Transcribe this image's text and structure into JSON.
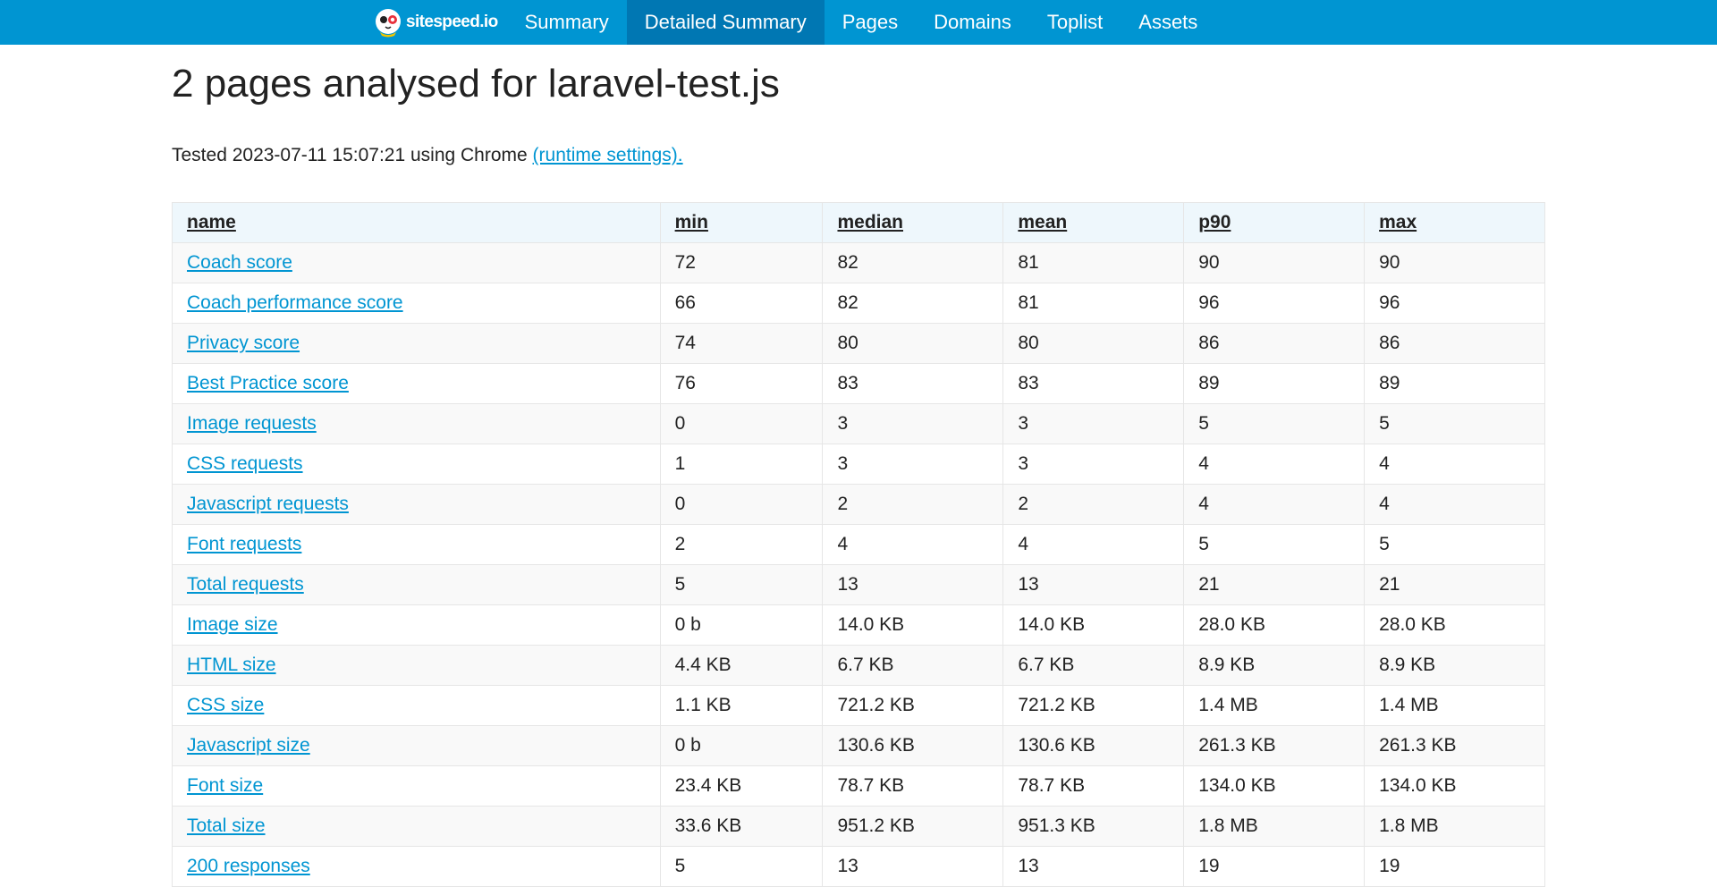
{
  "brand": {
    "name": "sitespeed.io"
  },
  "nav": {
    "items": [
      {
        "label": "Summary",
        "active": false
      },
      {
        "label": "Detailed Summary",
        "active": true
      },
      {
        "label": "Pages",
        "active": false
      },
      {
        "label": "Domains",
        "active": false
      },
      {
        "label": "Toplist",
        "active": false
      },
      {
        "label": "Assets",
        "active": false
      }
    ]
  },
  "page": {
    "title": "2 pages analysed for laravel-test.js",
    "tested_prefix": "Tested 2023-07-11 15:07:21 using Chrome ",
    "runtime_link": "(runtime settings)."
  },
  "table": {
    "headers": [
      "name",
      "min",
      "median",
      "mean",
      "p90",
      "max"
    ],
    "rows": [
      {
        "name": "Coach score",
        "min": "72",
        "median": "82",
        "mean": "81",
        "p90": "90",
        "max": "90"
      },
      {
        "name": "Coach performance score",
        "min": "66",
        "median": "82",
        "mean": "81",
        "p90": "96",
        "max": "96"
      },
      {
        "name": "Privacy score",
        "min": "74",
        "median": "80",
        "mean": "80",
        "p90": "86",
        "max": "86"
      },
      {
        "name": "Best Practice score",
        "min": "76",
        "median": "83",
        "mean": "83",
        "p90": "89",
        "max": "89"
      },
      {
        "name": "Image requests",
        "min": "0",
        "median": "3",
        "mean": "3",
        "p90": "5",
        "max": "5"
      },
      {
        "name": "CSS requests",
        "min": "1",
        "median": "3",
        "mean": "3",
        "p90": "4",
        "max": "4"
      },
      {
        "name": "Javascript requests",
        "min": "0",
        "median": "2",
        "mean": "2",
        "p90": "4",
        "max": "4"
      },
      {
        "name": "Font requests",
        "min": "2",
        "median": "4",
        "mean": "4",
        "p90": "5",
        "max": "5"
      },
      {
        "name": "Total requests",
        "min": "5",
        "median": "13",
        "mean": "13",
        "p90": "21",
        "max": "21"
      },
      {
        "name": "Image size",
        "min": "0 b",
        "median": "14.0 KB",
        "mean": "14.0 KB",
        "p90": "28.0 KB",
        "max": "28.0 KB"
      },
      {
        "name": "HTML size",
        "min": "4.4 KB",
        "median": "6.7 KB",
        "mean": "6.7 KB",
        "p90": "8.9 KB",
        "max": "8.9 KB"
      },
      {
        "name": "CSS size",
        "min": "1.1 KB",
        "median": "721.2 KB",
        "mean": "721.2 KB",
        "p90": "1.4 MB",
        "max": "1.4 MB"
      },
      {
        "name": "Javascript size",
        "min": "0 b",
        "median": "130.6 KB",
        "mean": "130.6 KB",
        "p90": "261.3 KB",
        "max": "261.3 KB"
      },
      {
        "name": "Font size",
        "min": "23.4 KB",
        "median": "78.7 KB",
        "mean": "78.7 KB",
        "p90": "134.0 KB",
        "max": "134.0 KB"
      },
      {
        "name": "Total size",
        "min": "33.6 KB",
        "median": "951.2 KB",
        "mean": "951.3 KB",
        "p90": "1.8 MB",
        "max": "1.8 MB"
      },
      {
        "name": "200 responses",
        "min": "5",
        "median": "13",
        "mean": "13",
        "p90": "19",
        "max": "19"
      }
    ]
  },
  "colors": {
    "topbar": "#0095d2",
    "topbar_active": "#0077b3",
    "link": "#0095d2",
    "header_row": "#eef7fc"
  }
}
